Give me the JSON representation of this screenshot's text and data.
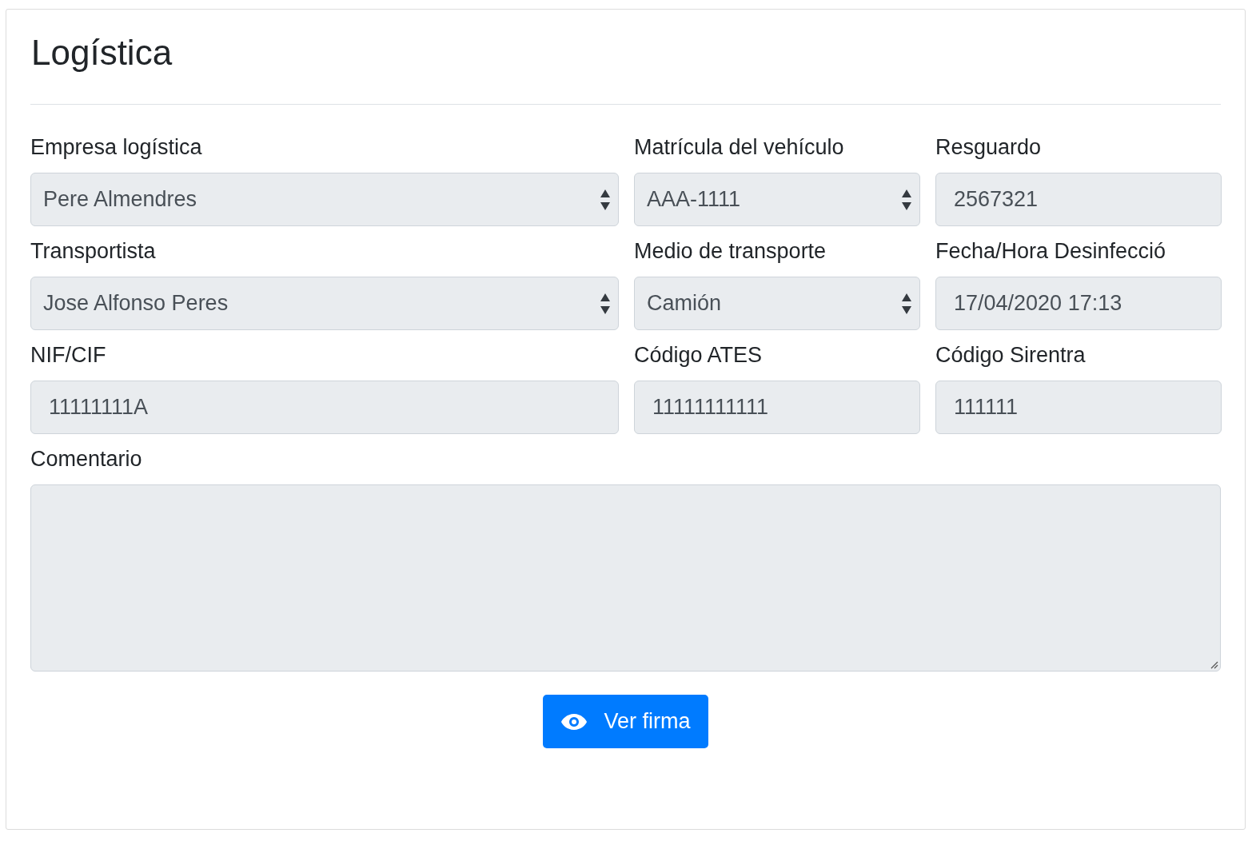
{
  "title": "Logística",
  "fields": [
    {
      "label": "Empresa logística",
      "kind": "select",
      "value": "Pere Almendres",
      "disabled": true
    },
    {
      "label": "Matrícula del vehículo",
      "kind": "select",
      "value": "AAA-1111",
      "disabled": true
    },
    {
      "label": "Resguardo",
      "kind": "input",
      "value": "2567321",
      "disabled": true
    },
    {
      "label": "Transportista",
      "kind": "select",
      "value": "Jose Alfonso Peres",
      "disabled": true
    },
    {
      "label": "Medio de transporte",
      "kind": "select",
      "value": "Camión",
      "disabled": true
    },
    {
      "label": "Fecha/Hora Desinfecció",
      "kind": "input",
      "value": "17/04/2020 17:13",
      "disabled": true
    },
    {
      "label": "NIF/CIF",
      "kind": "input",
      "value": "11111111A",
      "disabled": true
    },
    {
      "label": "Código ATES",
      "kind": "input",
      "value": "11111111111",
      "disabled": true
    },
    {
      "label": "Código Sirentra",
      "kind": "input",
      "value": "111111",
      "disabled": true
    }
  ],
  "comment": {
    "label": "Comentario",
    "disabled": true
  },
  "button": {
    "label": "Ver firma"
  }
}
